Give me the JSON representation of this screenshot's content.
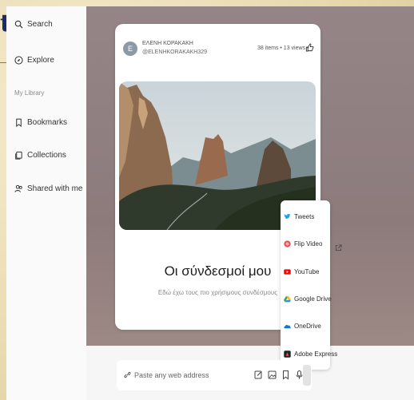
{
  "frame": {
    "corner_letter": "t"
  },
  "sidebar": {
    "items_top": [
      {
        "label": "Search",
        "icon": "search-icon"
      },
      {
        "label": "Explore",
        "icon": "compass-icon"
      }
    ],
    "library_heading": "My Library",
    "items_library": [
      {
        "label": "Bookmarks",
        "icon": "bookmark-icon"
      },
      {
        "label": "Collections",
        "icon": "collections-icon"
      },
      {
        "label": "Shared with me",
        "icon": "users-icon"
      }
    ]
  },
  "card": {
    "avatar_letter": "E",
    "author_name": "ΕΛΕΝΗ ΚΟΡΑΚΑΚΗ",
    "author_handle": "@ELENHKORAKAKH329",
    "stats": "38 items • 13 views •",
    "title": "Οι σύνδεσμοί μου",
    "description": "Εδώ έχω τους πιο χρήσιμους συνδέσμους"
  },
  "share_menu": {
    "items": [
      {
        "label": "Tweets",
        "icon": "twitter-icon",
        "color": "#1da1f2"
      },
      {
        "label": "Flip Video",
        "icon": "flip-icon",
        "color": "#e8514d"
      },
      {
        "label": "YouTube",
        "icon": "youtube-icon",
        "color": "#ff0000"
      },
      {
        "label": "Google Drive",
        "icon": "google-drive-icon",
        "color": "#34a853"
      },
      {
        "label": "OneDrive",
        "icon": "onedrive-icon",
        "color": "#0f78d4"
      },
      {
        "label": "Adobe Express",
        "icon": "adobe-express-icon",
        "color": "#222222"
      }
    ]
  },
  "address_bar": {
    "placeholder": "Paste any web address",
    "value": ""
  },
  "colors": {
    "canvas_background": "#958587",
    "accent_blue": "#1f2a6b"
  }
}
